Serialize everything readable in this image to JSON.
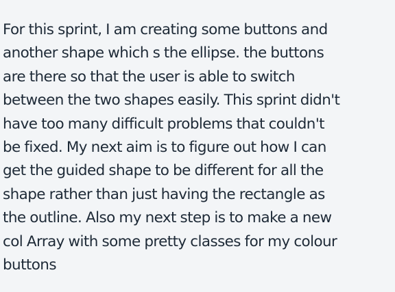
{
  "post": {
    "lines": [
      "For this sprint, I am creating some buttons and",
      "another shape which s the ellipse. the buttons",
      "are there so that the user is able to switch",
      "between the two shapes easily. This sprint didn't",
      "have too many difficult problems that couldn't",
      "be fixed. My next aim is to figure out how I can",
      "get the guided shape to be different for all the",
      "shape rather than just having the rectangle as",
      "the outline. Also my next step is to make a new",
      "col Array with some pretty classes for my colour",
      "buttons"
    ]
  },
  "colors": {
    "background": "#f3f5f7",
    "text": "#1e2a37"
  }
}
